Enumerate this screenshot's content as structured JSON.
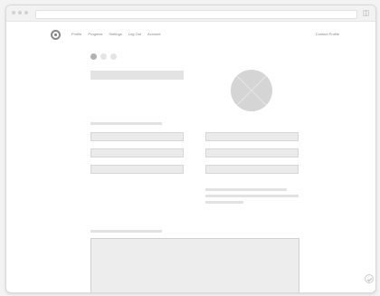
{
  "nav": {
    "links": [
      "Profile",
      "Progress",
      "Settings",
      "Log Out",
      "Account"
    ],
    "right": "Contact Profile"
  },
  "steps": {
    "count": 3,
    "active_index": 0
  },
  "icons": {
    "logo": "logo-icon",
    "menu": "hamburger-menu-icon",
    "avatar": "image-placeholder-icon",
    "help": "chevron-icon"
  },
  "colors": {
    "accent": "#b2b2b2",
    "placeholder": "#e3e3e3",
    "field_border": "#d6d6d6"
  }
}
